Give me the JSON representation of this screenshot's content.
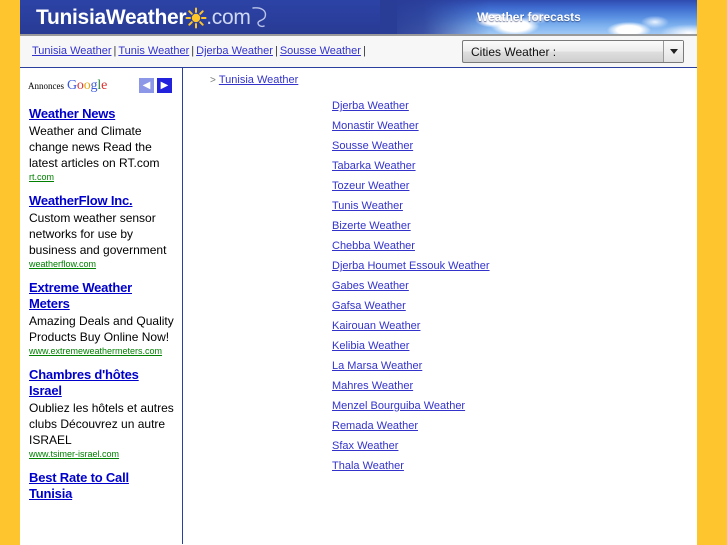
{
  "site": {
    "logo_main": "TunisiaWeather",
    "logo_sun_icon": "sun-icon",
    "logo_domain": ".com",
    "tagline": "Weather forecasts"
  },
  "nav": {
    "links": [
      "Tunisia Weather",
      "Tunis Weather",
      "Djerba Weather",
      "Sousse Weather"
    ],
    "separator": "|",
    "city_select": {
      "selected": "Cities Weather :",
      "caret_icon": "chevron-down-icon"
    }
  },
  "sidebar": {
    "ads_header": {
      "annonces": "Annonces",
      "google": "Google",
      "prev_icon": "chevron-left-icon",
      "next_icon": "chevron-right-icon",
      "prev_label": "◀",
      "next_label": "▶"
    },
    "ads": [
      {
        "title": "Weather News",
        "desc": "Weather and Climate change news Read the latest articles on RT.com",
        "url": "rt.com"
      },
      {
        "title": "WeatherFlow Inc.",
        "desc": "Custom weather sensor networks for use by business and government",
        "url": "weatherflow.com"
      },
      {
        "title": "Extreme Weather Meters",
        "desc": "Amazing Deals and Quality Products Buy Online Now!",
        "url": "www.extremeweathermeters.com"
      },
      {
        "title": "Chambres d'hôtes Israel",
        "desc": "Oubliez les hôtels et autres clubs Découvrez un autre ISRAEL",
        "url": "www.tsimer-israel.com"
      },
      {
        "title": "Best Rate to Call Tunisia",
        "desc": "",
        "url": ""
      }
    ]
  },
  "main": {
    "breadcrumb": {
      "marker": ">",
      "current": "Tunisia Weather"
    },
    "cities": [
      "Djerba Weather",
      "Monastir Weather",
      "Sousse Weather",
      "Tabarka Weather",
      "Tozeur Weather",
      "Tunis Weather",
      "Bizerte Weather",
      "Chebba Weather",
      "Djerba Houmet Essouk Weather",
      "Gabes Weather",
      "Gafsa Weather",
      "Kairouan Weather",
      "Kelibia Weather",
      "La Marsa Weather",
      "Mahres Weather",
      "Menzel Bourguiba Weather",
      "Remada Weather",
      "Sfax Weather",
      "Thala Weather"
    ]
  },
  "colors": {
    "frame_yellow": "#FFC52E",
    "banner_blue": "#2B3F9E",
    "link_blue": "#3333CC",
    "ad_title_blue": "#0000CC",
    "ad_url_green": "#008000"
  }
}
